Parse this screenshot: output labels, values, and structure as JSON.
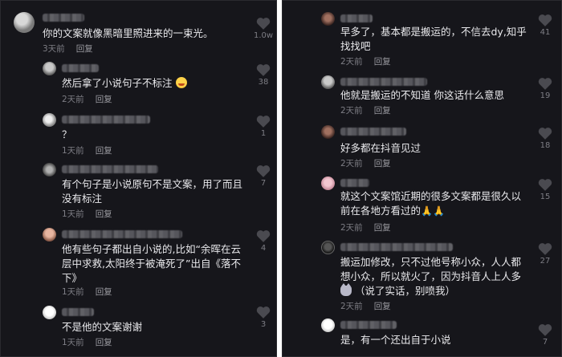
{
  "left_panel": {
    "comments": [
      {
        "text": "你的文案就像黑暗里照进来的一束光。",
        "time": "3天前",
        "reply": "回复",
        "likes": "1.0w"
      },
      {
        "text": "然后拿了小说句子不标注",
        "time": "2天前",
        "reply": "回复",
        "likes": "38"
      },
      {
        "text": "？",
        "time": "1天前",
        "reply": "回复",
        "likes": "1"
      },
      {
        "text": "有个句子是小说原句不是文案，用了而且\n没有标注",
        "time": "1天前",
        "reply": "回复",
        "likes": "7"
      },
      {
        "text": "他有些句子都出自小说的,比如“余晖在云\n层中求救,太阳终于被淹死了”出自《落不\n下》",
        "time": "1天前",
        "reply": "回复",
        "likes": "4"
      },
      {
        "text": "不是他的文案谢谢",
        "time": "1天前",
        "reply": "回复",
        "likes": "3"
      }
    ]
  },
  "right_panel": {
    "comments": [
      {
        "text": "早多了，基本都是搬运的，不信去dy,知乎\n找找吧",
        "time": "2天前",
        "reply": "回复",
        "likes": "41"
      },
      {
        "text": "他就是搬运的不知道 你这话什么意思",
        "time": "2天前",
        "reply": "回复",
        "likes": "19"
      },
      {
        "text": "好多都在抖音见过",
        "time": "2天前",
        "reply": "回复",
        "likes": "18"
      },
      {
        "text": "就这个文案馆近期的很多文案都是很久以\n前在各地方看过的",
        "emoji": "🙏🙏",
        "time": "2天前",
        "reply": "回复",
        "likes": "15"
      },
      {
        "text": "搬运加修改，只不过他号称小众，人人都\n想小众，所以就火了，因为抖音人上人多",
        "text_extra": "（说了实话，别喷我）",
        "time": "2天前",
        "reply": "回复",
        "likes": "27"
      },
      {
        "text": "是，有一个还出自于小说",
        "time": "",
        "reply": "",
        "likes": "7"
      }
    ]
  },
  "colors": {
    "background": "#16161b",
    "text": "#e9e9ec",
    "meta": "#7d7d84",
    "heart": "#4a4a50"
  }
}
